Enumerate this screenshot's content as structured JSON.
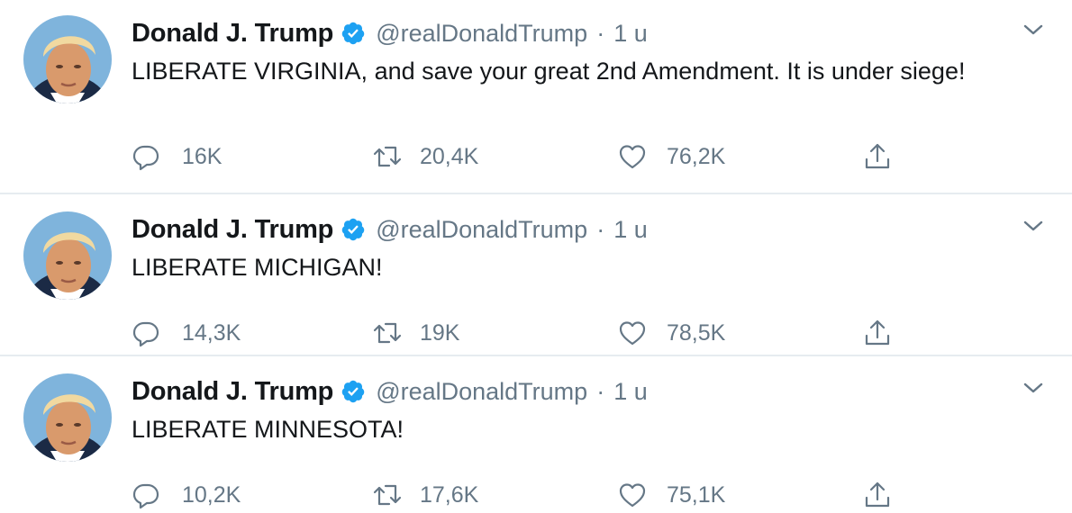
{
  "colors": {
    "text_primary": "#14171a",
    "text_secondary": "#657786",
    "verified_blue": "#1da1f2",
    "divider": "#e6ecf0"
  },
  "tweets": [
    {
      "name": "Donald J. Trump",
      "handle": "@realDonaldTrump",
      "separator": "·",
      "time": "1 u",
      "text": "LIBERATE VIRGINIA, and save your great 2nd Amendment. It is under siege!",
      "replies": "16K",
      "retweets": "20,4K",
      "likes": "76,2K",
      "icons": [
        "reply-icon",
        "retweet-icon",
        "like-icon",
        "share-icon",
        "chevron-down-icon",
        "verified-badge-icon"
      ]
    },
    {
      "name": "Donald J. Trump",
      "handle": "@realDonaldTrump",
      "separator": "·",
      "time": "1 u",
      "text": "LIBERATE MICHIGAN!",
      "replies": "14,3K",
      "retweets": "19K",
      "likes": "78,5K",
      "icons": [
        "reply-icon",
        "retweet-icon",
        "like-icon",
        "share-icon",
        "chevron-down-icon",
        "verified-badge-icon"
      ]
    },
    {
      "name": "Donald J. Trump",
      "handle": "@realDonaldTrump",
      "separator": "·",
      "time": "1 u",
      "text": "LIBERATE MINNESOTA!",
      "replies": "10,2K",
      "retweets": "17,6K",
      "likes": "75,1K",
      "icons": [
        "reply-icon",
        "retweet-icon",
        "like-icon",
        "share-icon",
        "chevron-down-icon",
        "verified-badge-icon"
      ]
    }
  ]
}
